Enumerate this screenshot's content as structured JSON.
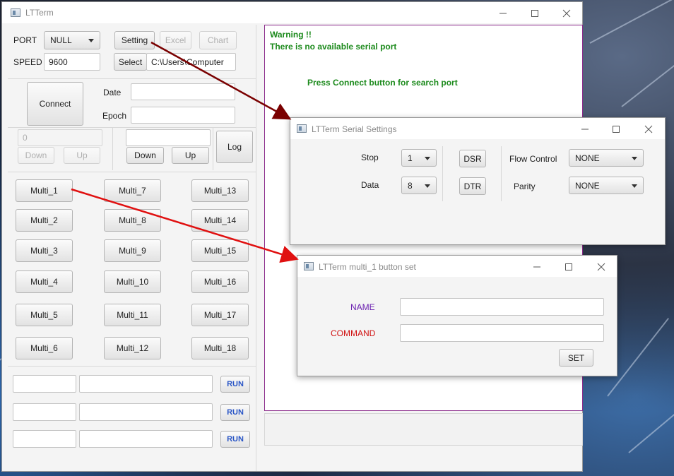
{
  "main_window": {
    "title": "LTTerm",
    "port_label": "PORT",
    "port_value": "NULL",
    "speed_label": "SPEED",
    "speed_value": "9600",
    "setting_label": "Setting",
    "excel_label": "Excel",
    "chart_label": "Chart",
    "select_label": "Select",
    "path_value": "C:\\Users\\Computer",
    "connect_label": "Connect",
    "date_label": "Date",
    "epoch_label": "Epoch",
    "counter_value": "0",
    "down_label": "Down",
    "up_label": "Up",
    "log_label": "Log",
    "multi_buttons": [
      "Multi_1",
      "Multi_2",
      "Multi_3",
      "Multi_4",
      "Multi_5",
      "Multi_6",
      "Multi_7",
      "Multi_8",
      "Multi_9",
      "Multi_10",
      "Multi_11",
      "Multi_12",
      "Multi_13",
      "Multi_14",
      "Multi_15",
      "Multi_16",
      "Multi_17",
      "Multi_18"
    ],
    "run_label": "RUN",
    "terminal": {
      "warning": "Warning !!",
      "no_port": "There is no available serial port",
      "hint": "Press Connect button for search port"
    }
  },
  "serial_settings": {
    "title": "LTTerm Serial Settings",
    "stop_label": "Stop",
    "stop_value": "1",
    "data_label": "Data",
    "data_value": "8",
    "dsr_label": "DSR",
    "dtr_label": "DTR",
    "flow_label": "Flow Control",
    "flow_value": "NONE",
    "parity_label": "Parity",
    "parity_value": "NONE"
  },
  "multi_dialog": {
    "title": "LTTerm multi_1 button set",
    "name_label": "NAME",
    "command_label": "COMMAND",
    "set_label": "SET"
  },
  "colors": {
    "arrow_dark": "#7a0000",
    "arrow_red": "#e01010",
    "name_color": "#6a1fb0",
    "command_color": "#d01010",
    "terminal_text": "#1c8a1c",
    "terminal_border": "#8a2a8a"
  }
}
